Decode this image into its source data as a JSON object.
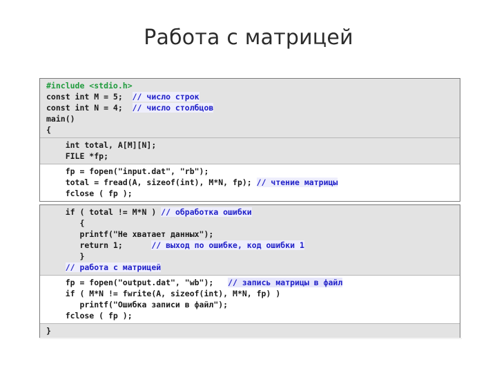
{
  "slide": {
    "title": "Работа с матрицей"
  },
  "code_figure": {
    "language": "c",
    "panels": [
      {
        "name": "panel-read-matrix",
        "bands": [
          {
            "shade": "gray",
            "lines": [
              {
                "segments": [
                  {
                    "text": "#include <stdio.h>",
                    "style": "kw-green"
                  }
                ]
              },
              {
                "segments": [
                  {
                    "text": "const int M = 5;  ",
                    "style": "plain"
                  },
                  {
                    "text": "// число строк",
                    "style": "comment"
                  }
                ]
              },
              {
                "segments": [
                  {
                    "text": "const int N = 4;  ",
                    "style": "plain"
                  },
                  {
                    "text": "// число столбцов",
                    "style": "comment"
                  }
                ]
              },
              {
                "segments": [
                  {
                    "text": "main()",
                    "style": "plain"
                  }
                ]
              },
              {
                "segments": [
                  {
                    "text": "{",
                    "style": "plain"
                  }
                ]
              }
            ]
          },
          {
            "shade": "gray",
            "lines": [
              {
                "segments": [
                  {
                    "text": "    int total, A[M][N];",
                    "style": "plain"
                  }
                ]
              },
              {
                "segments": [
                  {
                    "text": "    FILE *fp;",
                    "style": "plain"
                  }
                ]
              }
            ]
          },
          {
            "shade": "white",
            "lines": [
              {
                "segments": [
                  {
                    "text": "    fp = fopen(\"input.dat\", \"rb\");",
                    "style": "plain"
                  }
                ]
              },
              {
                "segments": [
                  {
                    "text": "    total = fread(A, sizeof(int), M*N, fp); ",
                    "style": "plain"
                  },
                  {
                    "text": "// чтение матрицы",
                    "style": "comment"
                  }
                ]
              },
              {
                "segments": [
                  {
                    "text": "    fclose ( fp );",
                    "style": "plain"
                  }
                ]
              }
            ]
          }
        ]
      },
      {
        "name": "panel-error-and-write",
        "bands": [
          {
            "shade": "gray",
            "lines": [
              {
                "segments": [
                  {
                    "text": "    if ( total != M*N ) ",
                    "style": "plain"
                  },
                  {
                    "text": "// обработка ошибки",
                    "style": "comment"
                  }
                ]
              },
              {
                "segments": [
                  {
                    "text": "       {",
                    "style": "plain"
                  }
                ]
              },
              {
                "segments": [
                  {
                    "text": "       printf(\"Не хватает данных\");",
                    "style": "plain"
                  }
                ]
              },
              {
                "segments": [
                  {
                    "text": "       return 1;      ",
                    "style": "plain"
                  },
                  {
                    "text": "// выход по ошибке, код ошибки 1",
                    "style": "comment"
                  }
                ]
              },
              {
                "segments": [
                  {
                    "text": "       }",
                    "style": "plain"
                  }
                ]
              },
              {
                "segments": [
                  {
                    "text": "    ",
                    "style": "plain"
                  },
                  {
                    "text": "// работа с матрицей",
                    "style": "comment"
                  }
                ]
              }
            ]
          },
          {
            "shade": "white",
            "lines": [
              {
                "segments": [
                  {
                    "text": "    fp = fopen(\"output.dat\", \"wb\");   ",
                    "style": "plain"
                  },
                  {
                    "text": "// запись матрицы в файл",
                    "style": "comment-hl"
                  }
                ]
              },
              {
                "segments": [
                  {
                    "text": "    if ( M*N != fwrite(A, sizeof(int), M*N, fp) )",
                    "style": "plain"
                  }
                ]
              },
              {
                "segments": [
                  {
                    "text": "       printf(\"Ошибка записи в файл\");",
                    "style": "plain"
                  }
                ]
              },
              {
                "segments": [
                  {
                    "text": "    fclose ( fp );",
                    "style": "plain"
                  }
                ]
              }
            ]
          },
          {
            "shade": "gray",
            "lines": [
              {
                "segments": [
                  {
                    "text": "}",
                    "style": "plain"
                  }
                ]
              }
            ]
          }
        ]
      }
    ]
  },
  "colors": {
    "page_background": "#ffffff",
    "title_text": "#2b2b2b",
    "code_text": "#1a1a1a",
    "comment_blue": "#2020c8",
    "preprocessor_green": "#1f9b3c",
    "band_gray": "#e3e3e3",
    "band_white": "#ffffff",
    "panel_border": "#7a7a7a",
    "comment_highlight": "#eeeefc"
  }
}
